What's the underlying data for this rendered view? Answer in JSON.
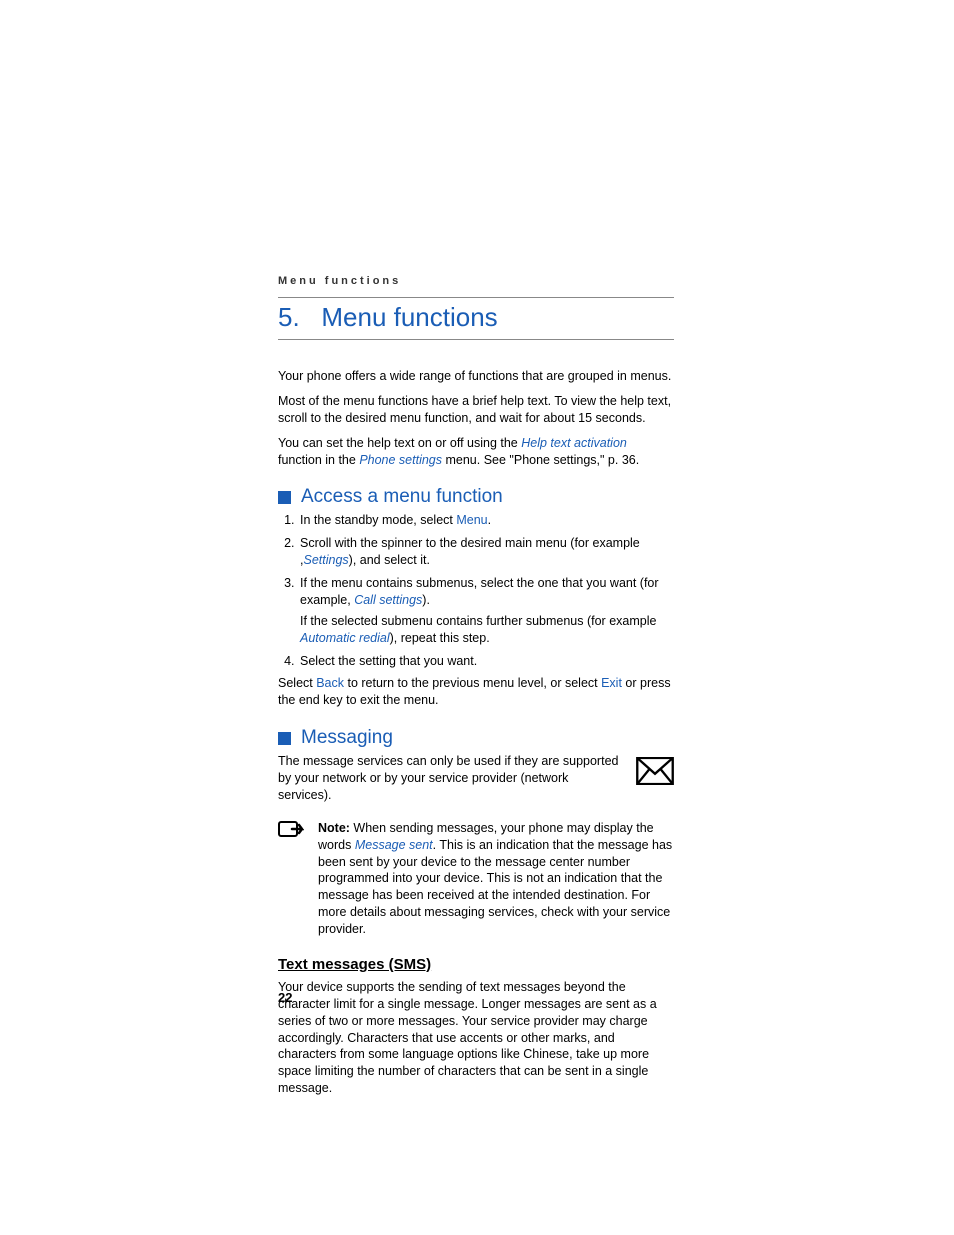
{
  "running_header": "Menu functions",
  "chapter": {
    "number": "5.",
    "title": "Menu functions"
  },
  "intro": {
    "p1": "Your phone offers a wide range of functions that are grouped in menus.",
    "p2": "Most of the menu functions have a brief help text. To view the help text, scroll to the desired menu function, and wait for about 15 seconds.",
    "p3_a": "You can set the help text on or off using the ",
    "p3_link1": "Help text activation",
    "p3_b": " function in the ",
    "p3_link2": "Phone settings",
    "p3_c": " menu. See \"Phone settings,\" p. 36."
  },
  "section_access": {
    "title": "Access a menu function",
    "step1_a": "In the standby mode, select ",
    "step1_link": "Menu",
    "step1_b": ".",
    "step2_a": "Scroll with the spinner to the desired main menu (for example ,",
    "step2_link": "Settings",
    "step2_b": "), and select it.",
    "step3_a": "If the menu contains submenus, select the one that you want (for example, ",
    "step3_link": "Call settings",
    "step3_b": ").",
    "step3_sub_a": "If the selected submenu contains further submenus (for example ",
    "step3_sub_link": "Automatic redial",
    "step3_sub_b": "), repeat this step.",
    "step4": "Select the setting that you want.",
    "after_a": "Select ",
    "after_link1": "Back",
    "after_b": " to return to the previous menu level, or select ",
    "after_link2": "Exit",
    "after_c": " or press the end key to exit the menu."
  },
  "section_messaging": {
    "title": "Messaging",
    "intro": "The message services can only be used if they are supported by your network or by your service provider (network services).",
    "note_label": "Note:",
    "note_a": " When sending messages, your phone may display the words ",
    "note_link": "Message sent",
    "note_b": ". This is an indication that the message has been sent by your device to the message center number programmed into your device. This is not an indication that the message has been received at the intended destination. For more details about messaging services, check with your service provider.",
    "sms_heading": "Text messages (SMS)",
    "sms_body": "Your device supports the sending of text messages beyond the character limit for a single message. Longer messages are sent as a series of two or more messages. Your service provider may charge accordingly. Characters that use accents or other marks, and characters from some language options like Chinese, take up more space limiting the number of characters that can be sent in a single message."
  },
  "page_number": "22"
}
